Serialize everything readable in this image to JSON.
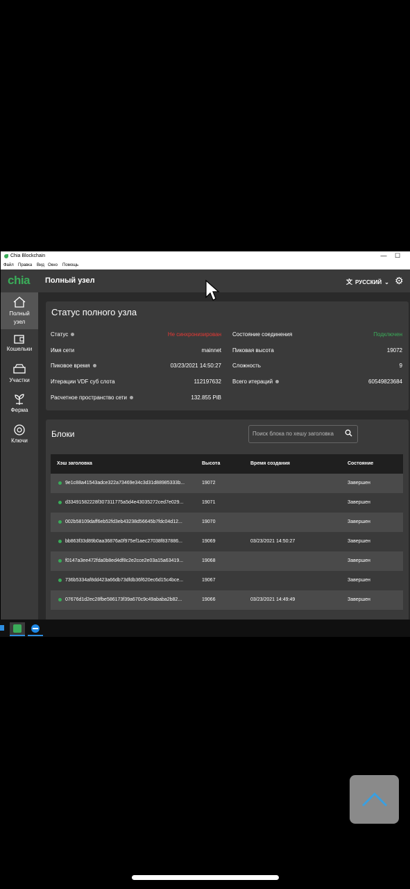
{
  "window": {
    "title": "Chia Blockchain",
    "controls": {
      "minimize": "—",
      "maximize": "☐"
    }
  },
  "menu": [
    "Файл",
    "Правка",
    "Вид",
    "Окно",
    "Помощь"
  ],
  "app": {
    "brand": "chia",
    "page_title": "Полный узел",
    "language": "РУССКИЙ"
  },
  "sidebar": [
    {
      "label": "Полный узел",
      "icon": "home-icon"
    },
    {
      "label": "Кошельки",
      "icon": "wallet-icon"
    },
    {
      "label": "Участки",
      "icon": "storage-icon"
    },
    {
      "label": "Ферма",
      "icon": "plant-icon"
    },
    {
      "label": "Ключи",
      "icon": "lifebuoy-icon"
    }
  ],
  "status": {
    "title": "Статус полного узла",
    "left": [
      {
        "label": "Статус",
        "value": "Не синхронизирован",
        "info": true,
        "color": "#e53935"
      },
      {
        "label": "Имя сети",
        "value": "mainnet",
        "info": false
      },
      {
        "label": "Пиковое время",
        "value": "03/23/2021 14:50:27",
        "info": true
      },
      {
        "label": "Итерации VDF суб слота",
        "value": "112197632",
        "info": false
      },
      {
        "label": "Расчетное пространство сети",
        "value": "132.855 PiB",
        "info": true
      }
    ],
    "right": [
      {
        "label": "Состояние соединения",
        "value": "Подключен",
        "color": "#3aac59"
      },
      {
        "label": "Пиковая высота",
        "value": "19072"
      },
      {
        "label": "Сложность",
        "value": "9"
      },
      {
        "label": "Всего итераций",
        "value": "60549823684",
        "info": true
      }
    ]
  },
  "blocks": {
    "title": "Блоки",
    "search_placeholder": "Поиск блока по хешу заголовка",
    "columns": [
      "Хэш заголовка",
      "Высота",
      "Время создания",
      "Состояние"
    ],
    "rows": [
      {
        "hash": "9e1c88a41543adce322a73469e34c3d31d88985333b...",
        "height": "19072",
        "time": "",
        "state": "Завершен"
      },
      {
        "hash": "d33491582228f307311775a5d4e43035272ced7e029...",
        "height": "19071",
        "time": "",
        "state": "Завершен"
      },
      {
        "hash": "002b58109daff6eb52fd3eb43238d56645b7fdc04d12...",
        "height": "19070",
        "time": "",
        "state": "Завершен"
      },
      {
        "hash": "bb863f33d89b0aa36876a0f975ef1aec27038f837886...",
        "height": "19069",
        "time": "03/23/2021 14:50:27",
        "state": "Завершен"
      },
      {
        "hash": "f0147a3ee472fda0b8ed4df8c2e2cce2e03a15a63419...",
        "height": "19068",
        "time": "",
        "state": "Завершен"
      },
      {
        "hash": "736b5334af8dd423a66db73dfdb36f620ec6d15c4bce...",
        "height": "19067",
        "time": "",
        "state": "Завершен"
      },
      {
        "hash": "07676d1d2ec28fbe586173f39a670c9c49ababa2b82...",
        "height": "19066",
        "time": "03/23/2021 14:49:49",
        "state": "Завершен"
      }
    ]
  },
  "colors": {
    "accent": "#3aac59",
    "error": "#e53935",
    "panel": "#3a3a3a",
    "background": "#2a2a2a"
  }
}
